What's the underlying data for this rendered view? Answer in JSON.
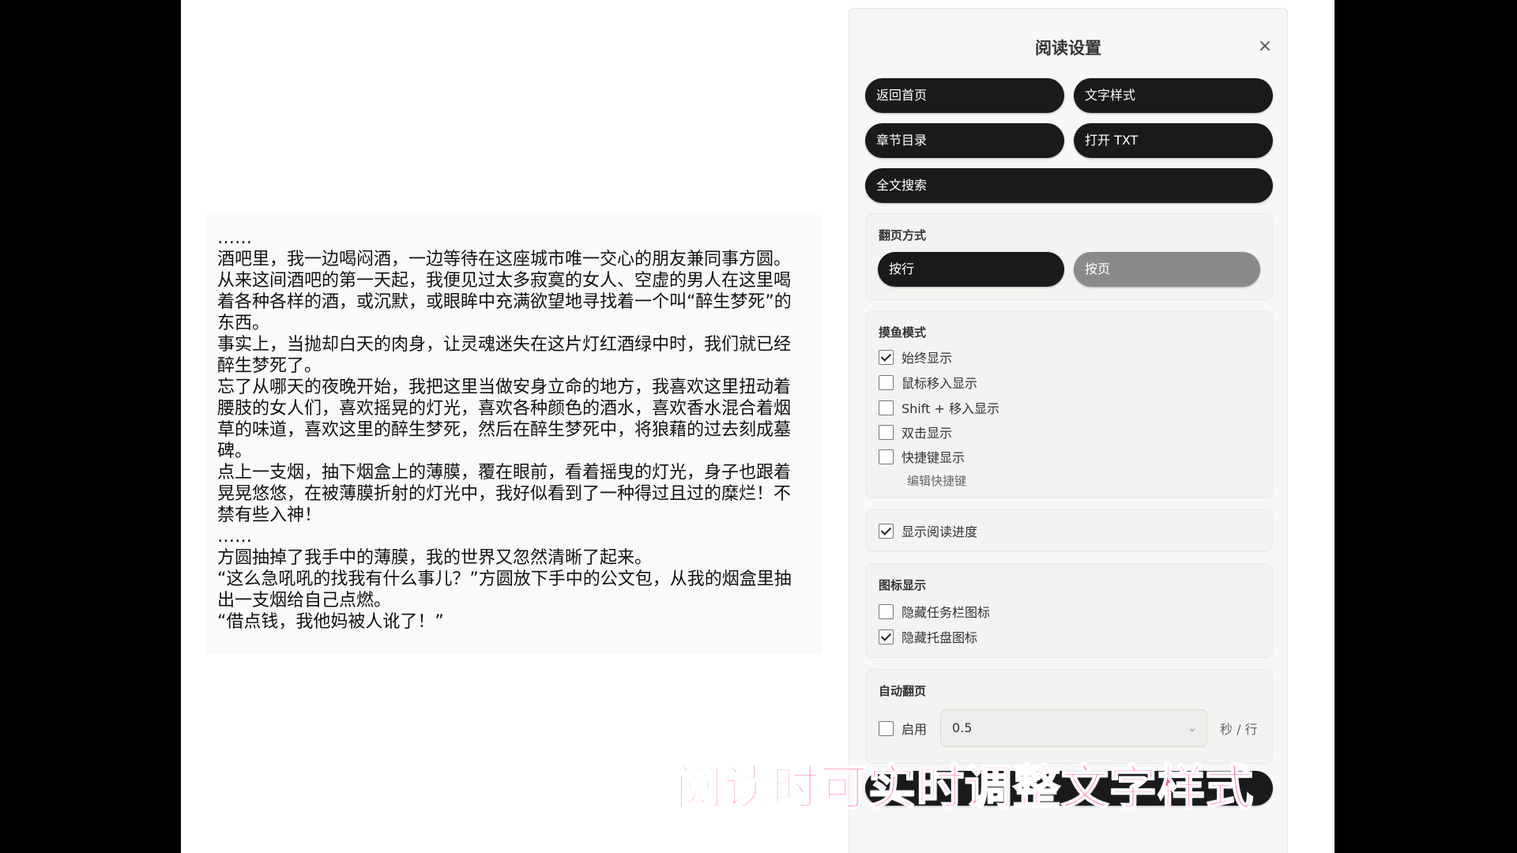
{
  "reader": {
    "paragraphs": [
      "……",
      "酒吧里，我一边喝闷酒，一边等待在这座城市唯一交心的朋友兼同事方圆。",
      "从来这间酒吧的第一天起，我便见过太多寂寞的女人、空虚的男人在这里喝着各种各样的酒，或沉默，或眼眸中充满欲望地寻找着一个叫“醉生梦死”的东西。",
      "事实上，当抛却白天的肉身，让灵魂迷失在这片灯红酒绿中时，我们就已经醉生梦死了。",
      "忘了从哪天的夜晚开始，我把这里当做安身立命的地方，我喜欢这里扭动着腰肢的女人们，喜欢摇晃的灯光，喜欢各种颜色的酒水，喜欢香水混合着烟草的味道，喜欢这里的醉生梦死，然后在醉生梦死中，将狼藉的过去刻成墓碑。",
      "点上一支烟，抽下烟盒上的薄膜，覆在眼前，看着摇曳的灯光，身子也跟着晃晃悠悠，在被薄膜折射的灯光中，我好似看到了一种得过且过的糜烂！不禁有些入神！",
      "……",
      "方圆抽掉了我手中的薄膜，我的世界又忽然清晰了起来。",
      "“这么急吼吼的找我有什么事儿？”方圆放下手中的公文包，从我的烟盒里抽出一支烟给自己点燃。",
      "“借点钱，我他妈被人讹了！”"
    ]
  },
  "panel": {
    "title": "阅读设置",
    "close": "×",
    "buttons": {
      "home": "返回首页",
      "text_style": "文字样式",
      "toc": "章节目录",
      "open_txt": "打开 TXT",
      "search": "全文搜索",
      "bottom": ""
    },
    "page_mode": {
      "title": "翻页方式",
      "by_line": "按行",
      "by_page": "按页",
      "selected": "按行"
    },
    "boss_mode": {
      "title": "摸鱼模式",
      "options": [
        {
          "label": "始终显示",
          "checked": true
        },
        {
          "label": "鼠标移入显示",
          "checked": false
        },
        {
          "label": "Shift + 移入显示",
          "checked": false
        },
        {
          "label": "双击显示",
          "checked": false
        },
        {
          "label": "快捷键显示",
          "checked": false
        }
      ],
      "edit_shortcut": "编辑快捷键"
    },
    "progress": {
      "label": "显示阅读进度",
      "checked": true
    },
    "icons": {
      "title": "图标显示",
      "options": [
        {
          "label": "隐藏任务栏图标",
          "checked": false
        },
        {
          "label": "隐藏托盘图标",
          "checked": true
        }
      ]
    },
    "auto_page": {
      "title": "自动翻页",
      "enable_label": "启用",
      "enabled": false,
      "interval": "0.5",
      "unit": "秒 / 行"
    }
  },
  "caption": "阅读时可实时调整文字样式",
  "colors": {
    "caption": "#ff5aa8",
    "button": "#1a1a1a",
    "button_inactive": "#8a8a8a"
  }
}
